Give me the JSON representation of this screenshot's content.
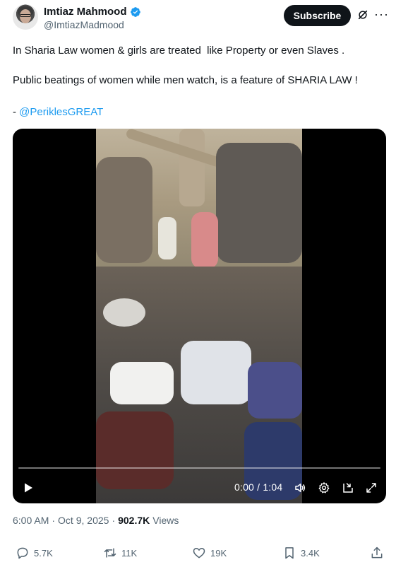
{
  "author": {
    "display_name": "Imtiaz Mahmood",
    "handle": "@ImtiazMadmood",
    "verified": true,
    "verified_color": "#1d9bf0"
  },
  "header": {
    "subscribe_label": "Subscribe",
    "grok_icon": "grok-icon",
    "more_label": "···"
  },
  "tweet": {
    "line1": "In Sharia Law women & girls are treated  like Property or even Slaves .",
    "line2": "Public beatings of women while men watch, is a feature of SHARIA LAW !",
    "line3_prefix": "- ",
    "line3_mention": "@PeriklesGREAT"
  },
  "video": {
    "time_display": "0:00 / 1:04",
    "progress": 0,
    "icons": [
      "play-icon",
      "volume-icon",
      "settings-icon",
      "pip-icon",
      "fullscreen-icon"
    ]
  },
  "meta": {
    "time": "6:00 AM",
    "separator": "·",
    "date": "Oct 9, 2025",
    "separator2": "·",
    "views_count": "902.7K",
    "views_label": "Views"
  },
  "actions": {
    "reply_count": "5.7K",
    "repost_count": "11K",
    "like_count": "19K",
    "bookmark_count": "3.4K"
  },
  "colors": {
    "accent": "#1d9bf0",
    "text": "#0f1419",
    "muted": "#536471"
  }
}
